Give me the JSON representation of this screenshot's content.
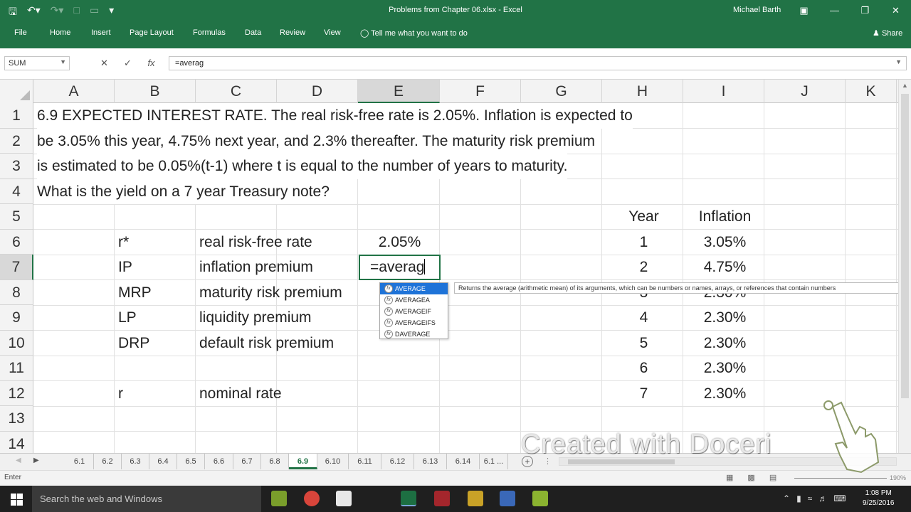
{
  "titlebar": {
    "title": "Problems from Chapter 06.xlsx - Excel",
    "user": "Michael Barth"
  },
  "ribbon": {
    "tabs": [
      "File",
      "Home",
      "Insert",
      "Page Layout",
      "Formulas",
      "Data",
      "Review",
      "View"
    ],
    "tell_me": "Tell me what you want to do",
    "share": "Share"
  },
  "formula_bar": {
    "name_box": "SUM",
    "formula": "=averag"
  },
  "columns": [
    "A",
    "B",
    "C",
    "D",
    "E",
    "F",
    "G",
    "H",
    "I",
    "J",
    "K"
  ],
  "rows": [
    "1",
    "2",
    "3",
    "4",
    "5",
    "6",
    "7",
    "8",
    "9",
    "10",
    "11",
    "12",
    "13",
    "14"
  ],
  "problem_text": [
    "6.9 EXPECTED INTEREST RATE. The real risk-free rate is 2.05%. Inflation is expected to",
    "be 3.05% this year, 4.75% next year, and 2.3% thereafter. The maturity risk premium",
    "is estimated to be 0.05%(t-1) where t is equal to the number of years to maturity.",
    "What is the yield on a 7 year Treasury note?"
  ],
  "table_left": [
    {
      "symbol": "r*",
      "label": "real risk-free rate",
      "value": "2.05%"
    },
    {
      "symbol": "IP",
      "label": "inflation premium",
      "value": ""
    },
    {
      "symbol": "MRP",
      "label": "maturity risk premium",
      "value": ""
    },
    {
      "symbol": "LP",
      "label": "liquidity premium",
      "value": ""
    },
    {
      "symbol": "DRP",
      "label": "default risk premium",
      "value": ""
    },
    {
      "symbol": "",
      "label": "",
      "value": ""
    },
    {
      "symbol": "r",
      "label": "nominal rate",
      "value": ""
    }
  ],
  "table_right": {
    "header_year": "Year",
    "header_inflation": "Inflation",
    "rows": [
      {
        "year": "1",
        "inflation": "3.05%"
      },
      {
        "year": "2",
        "inflation": "4.75%"
      },
      {
        "year": "3",
        "inflation": "2.30%"
      },
      {
        "year": "4",
        "inflation": "2.30%"
      },
      {
        "year": "5",
        "inflation": "2.30%"
      },
      {
        "year": "6",
        "inflation": "2.30%"
      },
      {
        "year": "7",
        "inflation": "2.30%"
      }
    ]
  },
  "active_cell": {
    "ref": "E7",
    "content": "=averag"
  },
  "autocomplete": {
    "items": [
      "AVERAGE",
      "AVERAGEA",
      "AVERAGEIF",
      "AVERAGEIFS",
      "DAVERAGE"
    ],
    "tooltip": "Returns the average (arithmetic mean) of its arguments, which can be numbers or names, arrays, or references that contain numbers"
  },
  "sheet_tabs": [
    "6.1",
    "6.2",
    "6.3",
    "6.4",
    "6.5",
    "6.6",
    "6.7",
    "6.8",
    "6.9",
    "6.10",
    "6.11",
    "6.12",
    "6.13",
    "6.14",
    "6.1 ..."
  ],
  "active_sheet": "6.9",
  "status": {
    "mode": "Enter",
    "zoom": "190%"
  },
  "taskbar": {
    "search_placeholder": "Search the web and Windows",
    "time": "1:08 PM",
    "date": "9/25/2016"
  },
  "watermark": "Created with Doceri",
  "colors": {
    "excel_green": "#217346",
    "selection_blue": "#1e73d8"
  }
}
